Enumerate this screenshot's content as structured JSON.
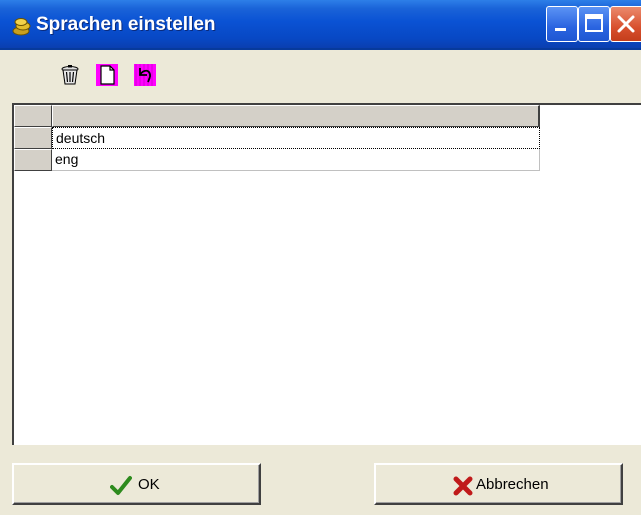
{
  "window": {
    "title": "Sprachen einstellen"
  },
  "toolbar": {
    "buttons": [
      {
        "icon": "trash-icon"
      },
      {
        "icon": "new-document-icon"
      },
      {
        "icon": "undo-icon"
      }
    ]
  },
  "grid": {
    "columns": [
      ""
    ],
    "rows": [
      {
        "value": "deutsch"
      },
      {
        "value": "eng"
      }
    ]
  },
  "footer": {
    "ok_label": "OK",
    "cancel_label": "Abbrechen"
  },
  "colors": {
    "title_bar": "#0a52d4",
    "ok_check": "#2e8b1e",
    "cancel_x": "#c01a1a",
    "toolbar_accent": "#ff00ff"
  }
}
